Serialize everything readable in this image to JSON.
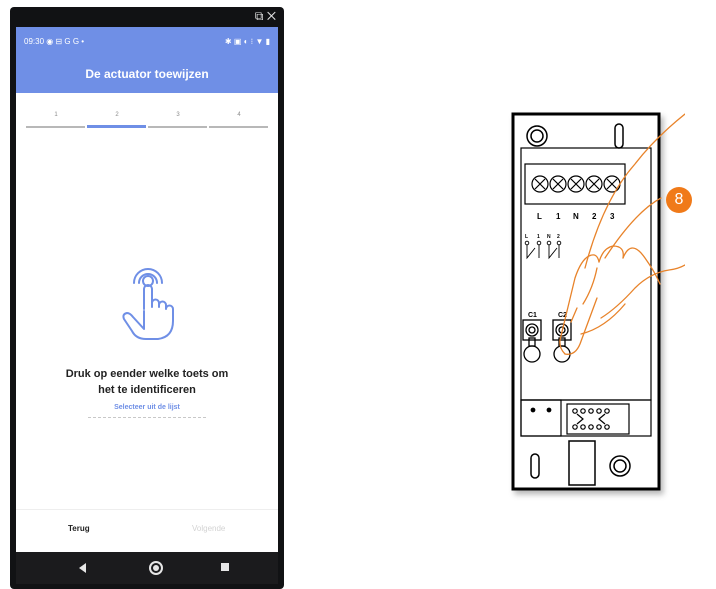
{
  "status_bar": {
    "time": "09:30",
    "left_icons": "◉ ⊟ G G •",
    "right_icons": "✱ ▣ ◐ ⁝ ▼ ▮"
  },
  "window_controls": [
    "edit-icon",
    "close-icon"
  ],
  "header": {
    "title": "De actuator toewijzen"
  },
  "stepper": {
    "steps": [
      "1",
      "2",
      "3",
      "4"
    ],
    "active_step": "2"
  },
  "main": {
    "icon": "touch-icon",
    "instruction_line1": "Druk op eender welke toets om",
    "instruction_line2": "het te identificeren",
    "select_link": "Selecteer uit de lijst"
  },
  "footer": {
    "back_label": "Terug",
    "next_label": "Volgende"
  },
  "nav": [
    "back-icon",
    "home-icon",
    "recent-apps-icon"
  ],
  "device": {
    "terminal_labels": [
      "L",
      "1",
      "N",
      "2",
      "3"
    ],
    "small_terminal_labels": [
      "L",
      "1",
      "N",
      "2"
    ],
    "contact_labels": [
      "C1",
      "C2"
    ],
    "step_badge": "8"
  },
  "colors": {
    "accent": "#6f8fe6",
    "badge": "#f07a19",
    "finger_line": "#e8832a"
  }
}
